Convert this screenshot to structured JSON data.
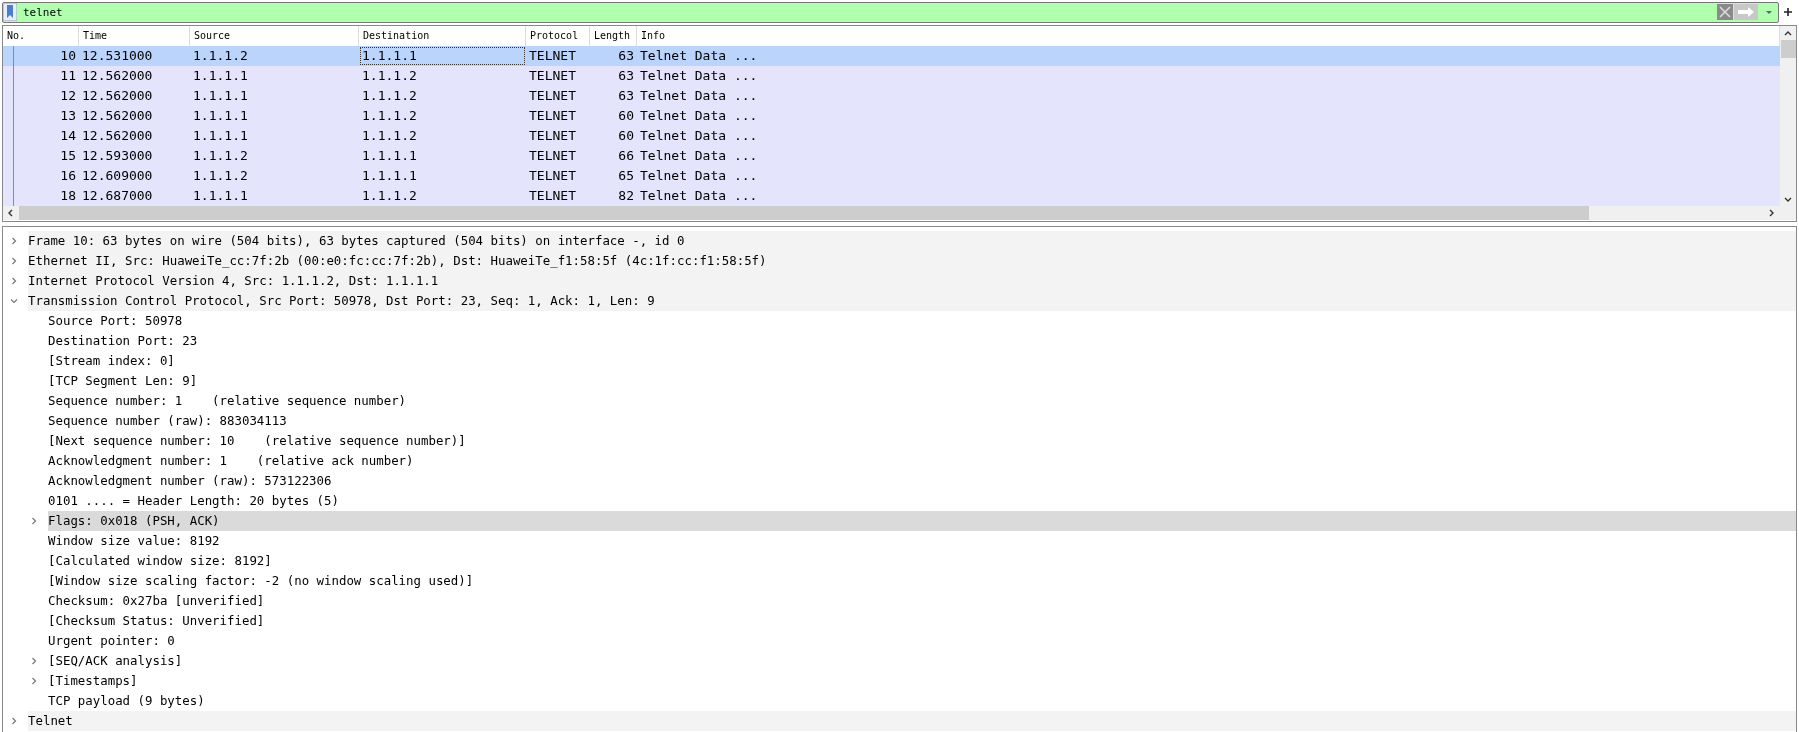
{
  "filter": {
    "value": "telnet"
  },
  "packet_list": {
    "columns": [
      "No.",
      "Time",
      "Source",
      "Destination",
      "Protocol",
      "Length",
      "Info"
    ],
    "rows": [
      {
        "cells": [
          "10",
          "12.531000",
          "1.1.1.2",
          "1.1.1.1",
          "TELNET",
          "63",
          "Telnet Data ..."
        ],
        "selected": true
      },
      {
        "cells": [
          "11",
          "12.562000",
          "1.1.1.1",
          "1.1.1.2",
          "TELNET",
          "63",
          "Telnet Data ..."
        ],
        "selected": false
      },
      {
        "cells": [
          "12",
          "12.562000",
          "1.1.1.1",
          "1.1.1.2",
          "TELNET",
          "63",
          "Telnet Data ..."
        ],
        "selected": false
      },
      {
        "cells": [
          "13",
          "12.562000",
          "1.1.1.1",
          "1.1.1.2",
          "TELNET",
          "60",
          "Telnet Data ..."
        ],
        "selected": false
      },
      {
        "cells": [
          "14",
          "12.562000",
          "1.1.1.1",
          "1.1.1.2",
          "TELNET",
          "60",
          "Telnet Data ..."
        ],
        "selected": false
      },
      {
        "cells": [
          "15",
          "12.593000",
          "1.1.1.2",
          "1.1.1.1",
          "TELNET",
          "66",
          "Telnet Data ..."
        ],
        "selected": false
      },
      {
        "cells": [
          "16",
          "12.609000",
          "1.1.1.2",
          "1.1.1.1",
          "TELNET",
          "65",
          "Telnet Data ..."
        ],
        "selected": false
      },
      {
        "cells": [
          "18",
          "12.687000",
          "1.1.1.1",
          "1.1.1.2",
          "TELNET",
          "82",
          "Telnet Data ..."
        ],
        "selected": false
      }
    ]
  },
  "details": [
    {
      "text": "Frame 10: 63 bytes on wire (504 bits), 63 bytes captured (504 bits) on interface -, id 0",
      "expanded": false,
      "highlighted": false
    },
    {
      "text": "Ethernet II, Src: HuaweiTe_cc:7f:2b (00:e0:fc:cc:7f:2b), Dst: HuaweiTe_f1:58:5f (4c:1f:cc:f1:58:5f)",
      "expanded": false,
      "highlighted": false
    },
    {
      "text": "Internet Protocol Version 4, Src: 1.1.1.2, Dst: 1.1.1.1",
      "expanded": false,
      "highlighted": false
    },
    {
      "text": "Transmission Control Protocol, Src Port: 50978, Dst Port: 23, Seq: 1, Ack: 1, Len: 9",
      "expanded": true,
      "highlighted": false,
      "children": [
        {
          "text": "Source Port: 50978",
          "highlighted": false
        },
        {
          "text": "Destination Port: 23",
          "highlighted": false
        },
        {
          "text": "[Stream index: 0]",
          "highlighted": false
        },
        {
          "text": "[TCP Segment Len: 9]",
          "highlighted": false
        },
        {
          "text": "Sequence number: 1    (relative sequence number)",
          "highlighted": false
        },
        {
          "text": "Sequence number (raw): 883034113",
          "highlighted": false
        },
        {
          "text": "[Next sequence number: 10    (relative sequence number)]",
          "highlighted": false
        },
        {
          "text": "Acknowledgment number: 1    (relative ack number)",
          "highlighted": false
        },
        {
          "text": "Acknowledgment number (raw): 573122306",
          "highlighted": false
        },
        {
          "text": "0101 .... = Header Length: 20 bytes (5)",
          "highlighted": false
        },
        {
          "text": "Flags: 0x018 (PSH, ACK)",
          "expanded": false,
          "highlighted": true
        },
        {
          "text": "Window size value: 8192",
          "highlighted": false
        },
        {
          "text": "[Calculated window size: 8192]",
          "highlighted": false
        },
        {
          "text": "[Window size scaling factor: -2 (no window scaling used)]",
          "highlighted": false
        },
        {
          "text": "Checksum: 0x27ba [unverified]",
          "highlighted": false
        },
        {
          "text": "[Checksum Status: Unverified]",
          "highlighted": false
        },
        {
          "text": "Urgent pointer: 0",
          "highlighted": false
        },
        {
          "text": "[SEQ/ACK analysis]",
          "expanded": false,
          "highlighted": false
        },
        {
          "text": "[Timestamps]",
          "expanded": false,
          "highlighted": false
        },
        {
          "text": "TCP payload (9 bytes)",
          "highlighted": false
        }
      ]
    },
    {
      "text": "Telnet",
      "expanded": false,
      "highlighted": false
    }
  ]
}
